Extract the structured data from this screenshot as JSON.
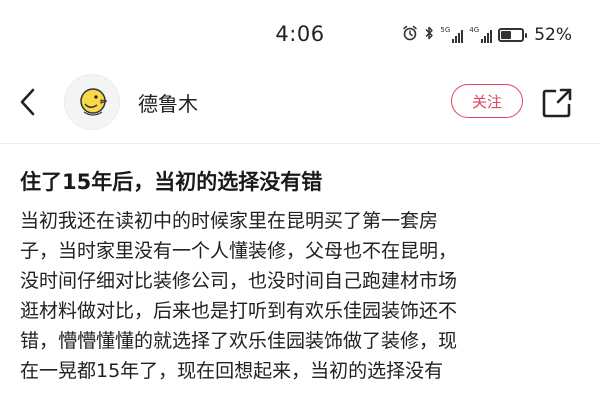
{
  "status_bar": {
    "time": "4:06",
    "signal_1_tag": "5G",
    "signal_2_tag": "4G",
    "battery_percent": "52%",
    "battery_level": 0.52
  },
  "header": {
    "author_name": "德鲁木",
    "follow_label": "关注",
    "accent_color": "#e0465d"
  },
  "article": {
    "title": "住了15年后，当初的选择没有错",
    "body_lines": [
      "当初我还在读初中的时候家里在昆明买了第一套房",
      "子，当时家里没有一个人懂装修，父母也不在昆明，",
      "没时间仔细对比装修公司，也没时间自己跑建材市场",
      "逛材料做对比，后来也是打听到有欢乐佳园装饰还不",
      "错，懵懵懂懂的就选择了欢乐佳园装饰做了装修，现",
      "在一晃都15年了，现在回想起来，当初的选择没有"
    ]
  }
}
